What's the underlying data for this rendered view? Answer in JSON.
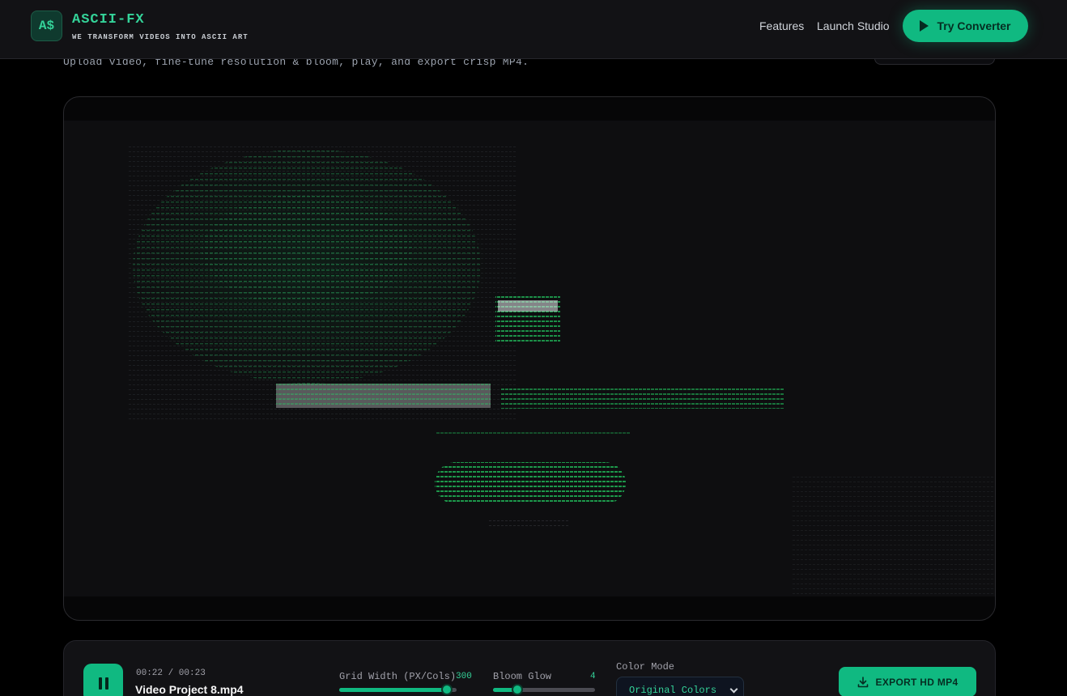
{
  "header": {
    "logo_text": "A$",
    "brand": "ASCII-FX",
    "tagline": "WE TRANSFORM VIDEOS INTO ASCII ART",
    "nav": [
      "Features",
      "Launch Studio"
    ],
    "cta_label": "Try Converter"
  },
  "page": {
    "subtitle": "Upload video, fine-tune resolution & bloom, play, and export crisp MP4."
  },
  "player": {
    "time": "00:22 / 00:23",
    "filename": "Video Project 8.mp4",
    "grid_width": {
      "label": "Grid Width (PX/Cols)",
      "value": "300",
      "level": 0.92
    },
    "bloom_glow": {
      "label": "Bloom Glow",
      "value": "4",
      "level": 0.24
    },
    "color_mode": {
      "label": "Color Mode",
      "selected": "Original Colors"
    },
    "export_label": "EXPORT HD MP4"
  },
  "colors": {
    "accent": "#10b981",
    "accent_text": "#34d399",
    "background": "#000000"
  },
  "icons": [
    "play-icon",
    "pause-icon",
    "chevron-down-icon",
    "download-icon"
  ]
}
